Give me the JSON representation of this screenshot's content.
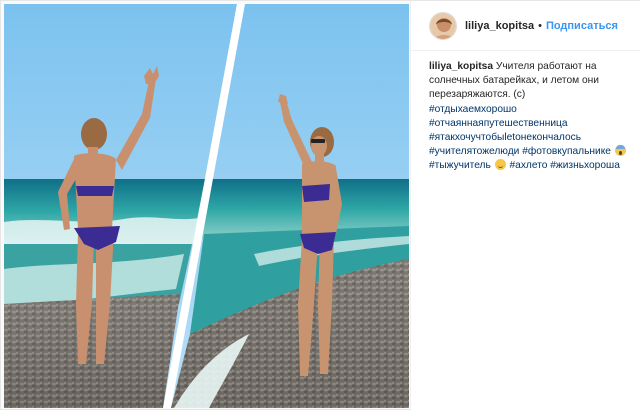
{
  "post": {
    "username": "liliya_kopitsa",
    "dot": "•",
    "follow_label": "Подписаться"
  },
  "caption": {
    "username": "liliya_kopitsa",
    "text_line1": "Учителя работают на",
    "text_line2": "солнечных батарейках, и летом они",
    "text_line3": "перезаряжаются. (с)",
    "tags": [
      "#отдыхаемхорошо",
      "#отчаяннаяпутешественница",
      "#ятакхочучтобыletонекончалось",
      "#учителятожелюди",
      "#фотовкупальнике",
      "#тыжучитель",
      "#ахлето",
      "#жизньхороша"
    ]
  },
  "icons": {
    "scream_emoji": "face-screaming-in-fear",
    "smile_emoji": "smiling-face-with-smiling-eyes"
  },
  "media": {
    "description_panels": 2
  }
}
